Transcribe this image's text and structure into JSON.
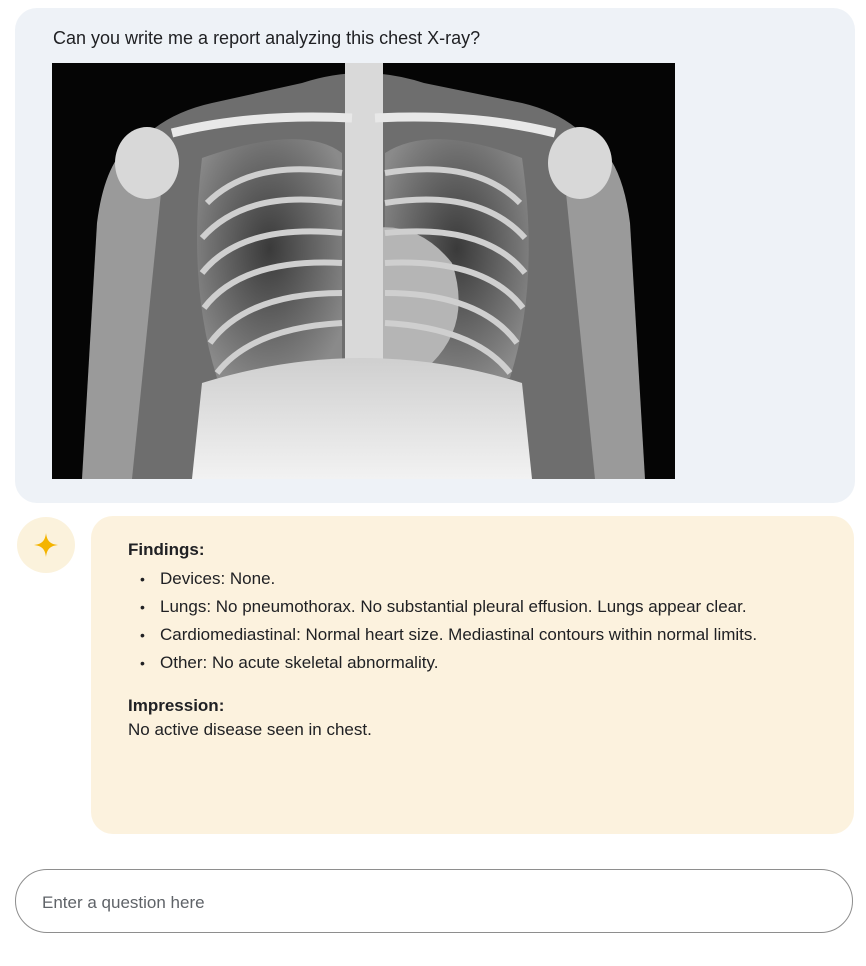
{
  "user_message": {
    "text": "Can you write me a report analyzing this chest X-ray?",
    "image_icon": "chest-xray-image"
  },
  "assistant_message": {
    "avatar_icon": "sparkle-icon",
    "accent_color": "#f4b400",
    "findings_title": "Findings:",
    "findings": [
      "Devices: None.",
      "Lungs: No pneumothorax. No substantial pleural effusion. Lungs appear clear.",
      "Cardiomediastinal: Normal heart size. Mediastinal contours within normal limits.",
      "Other: No acute skeletal abnormality."
    ],
    "impression_title": "Impression:",
    "impression_text": "No active disease seen in chest."
  },
  "composer": {
    "placeholder": "Enter a question here"
  }
}
